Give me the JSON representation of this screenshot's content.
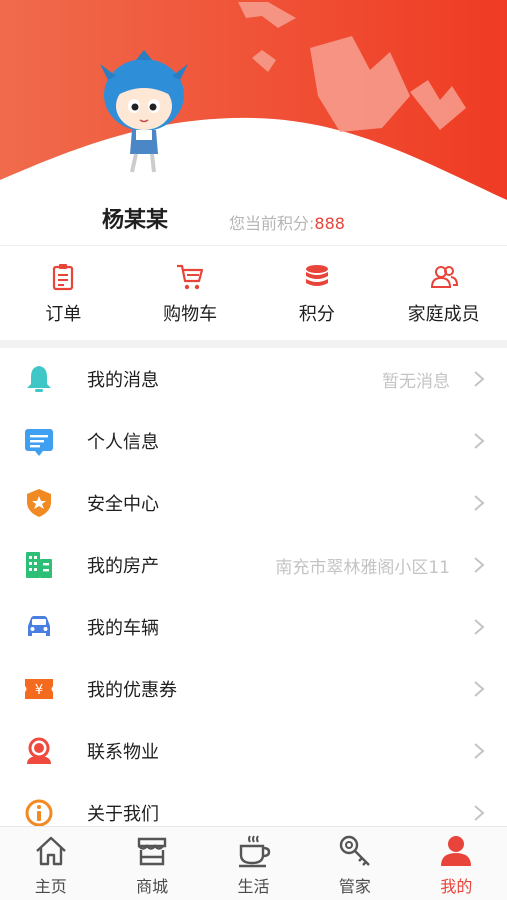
{
  "colors": {
    "accent": "#e8443a",
    "header_gradient_start": "#f06b4c",
    "header_gradient_end": "#ef3b23",
    "text_primary": "#1f1f1f",
    "text_muted": "#b5b5b5"
  },
  "profile": {
    "name": "杨某某",
    "points_label": "您当前积分:",
    "points_value": "888"
  },
  "quick_actions": [
    {
      "label": "订单",
      "icon": "clipboard-icon"
    },
    {
      "label": "购物车",
      "icon": "cart-icon"
    },
    {
      "label": "积分",
      "icon": "coins-icon"
    },
    {
      "label": "家庭成员",
      "icon": "family-icon"
    }
  ],
  "menu": [
    {
      "label": "我的消息",
      "value": "暂无消息",
      "icon": "bell-icon"
    },
    {
      "label": "个人信息",
      "value": "",
      "icon": "id-card-icon"
    },
    {
      "label": "安全中心",
      "value": "",
      "icon": "shield-icon"
    },
    {
      "label": "我的房产",
      "value": "南充市翠林雅阁小区11",
      "icon": "building-icon"
    },
    {
      "label": "我的车辆",
      "value": "",
      "icon": "car-icon"
    },
    {
      "label": "我的优惠券",
      "value": "",
      "icon": "coupon-icon"
    },
    {
      "label": "联系物业",
      "value": "",
      "icon": "service-icon"
    },
    {
      "label": "关于我们",
      "value": "",
      "icon": "info-icon"
    }
  ],
  "tabs": [
    {
      "label": "主页",
      "icon": "home-icon",
      "active": false
    },
    {
      "label": "商城",
      "icon": "store-icon",
      "active": false
    },
    {
      "label": "生活",
      "icon": "coffee-icon",
      "active": false
    },
    {
      "label": "管家",
      "icon": "key-icon",
      "active": false
    },
    {
      "label": "我的",
      "icon": "person-icon",
      "active": true
    }
  ]
}
